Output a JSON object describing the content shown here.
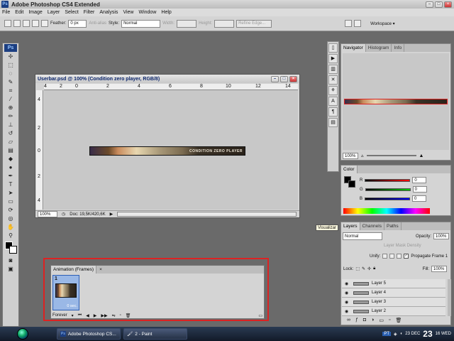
{
  "app": {
    "title": "Adobe Photoshop CS4 Extended",
    "logo": "Ps"
  },
  "menu": [
    "File",
    "Edit",
    "Image",
    "Layer",
    "Select",
    "Filter",
    "Analysis",
    "View",
    "Window",
    "Help"
  ],
  "options": {
    "feather_label": "Feather:",
    "feather_value": "0 px",
    "antialias_label": "Anti-alias",
    "style_label": "Style:",
    "style_value": "Normal",
    "width_label": "Width:",
    "height_label": "Height:",
    "refine_label": "Refine Edge...",
    "workspace_label": "Workspace ▾"
  },
  "doc": {
    "title": "Userbar.psd @ 100% (Condition zero player, RGB/8)",
    "ruler_top": [
      "4",
      "2",
      "0",
      "2",
      "4",
      "6",
      "8",
      "10",
      "12",
      "14"
    ],
    "ruler_left": [
      "4",
      "2",
      "0",
      "2",
      "4"
    ],
    "zoom": "100%",
    "doc_info": "Doc: 19,5K/420,6K",
    "banner_text": "CONDITION ZERO PLAYER"
  },
  "navigator": {
    "tabs": [
      "Navigator",
      "Histogram",
      "Info"
    ],
    "zoom": "100%"
  },
  "color": {
    "tab": "Color",
    "channels": [
      {
        "label": "R",
        "value": "0"
      },
      {
        "label": "G",
        "value": "0"
      },
      {
        "label": "B",
        "value": "0"
      }
    ]
  },
  "layers": {
    "tabs": [
      "Layers",
      "Channels",
      "Paths"
    ],
    "blend": "Normal",
    "opacity_label": "Opacity:",
    "opacity": "100%",
    "layer_mask": "Layer Mask Density",
    "unify": "Unify:",
    "propagate": "Propagate Frame 1",
    "lock_label": "Lock:",
    "fill_label": "Fill:",
    "fill": "100%",
    "items": [
      "Layer 5",
      "Layer 4",
      "Layer 3",
      "Layer 2"
    ]
  },
  "tooltip": "Visualizar",
  "animation": {
    "title": "Animation (Frames)",
    "frame_number": "1",
    "frame_time": "0 sec.",
    "loop": "Forever"
  },
  "taskbar": {
    "items": [
      "Adobe Photoshop CS...",
      "2 - Paint"
    ],
    "lang": "PT",
    "date": "23 DEC",
    "day": "23",
    "weekday": "16 WED"
  },
  "colors": {
    "accent": "#d22222",
    "titlebar_text": "#0a246a"
  }
}
